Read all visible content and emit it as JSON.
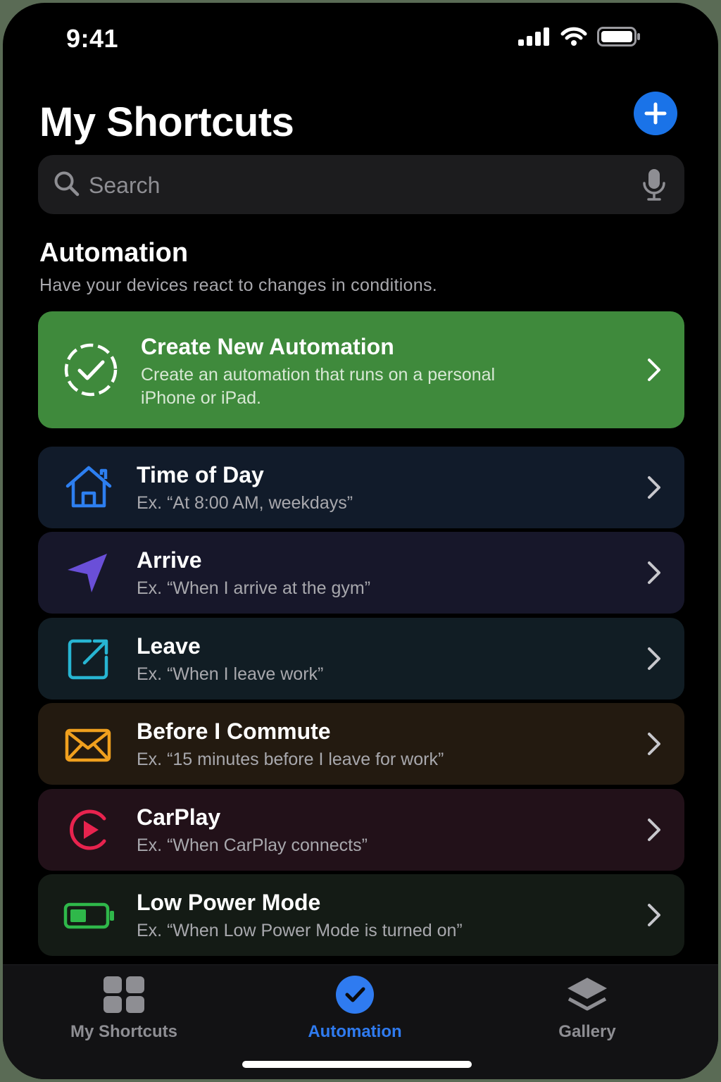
{
  "status_bar": {
    "time": "9:41"
  },
  "header": {
    "title": "My Shortcuts"
  },
  "search": {
    "placeholder": "Search"
  },
  "section": {
    "title": "Automation",
    "subtitle": "Have your devices react to changes in conditions."
  },
  "create_card": {
    "title": "Create New Automation",
    "desc": "Create an automation that runs on a personal iPhone or iPad."
  },
  "items": [
    {
      "title": "Time of Day",
      "desc": "Ex. “At 8:00 AM, weekdays”",
      "icon": "house-icon",
      "color": "#2d7ff0",
      "bg": "#111b2a"
    },
    {
      "title": "Arrive",
      "desc": "Ex. “When I arrive at the gym”",
      "icon": "location-arrow-icon",
      "color": "#6a4fd8",
      "bg": "#17172a"
    },
    {
      "title": "Leave",
      "desc": "Ex. “When I leave work”",
      "icon": "arrow-up-right-square-icon",
      "color": "#27b5d2",
      "bg": "#111d24"
    },
    {
      "title": "Before I Commute",
      "desc": "Ex. “15 minutes before I leave for work”",
      "icon": "envelope-icon",
      "color": "#f0a01e",
      "bg": "#231a10"
    },
    {
      "title": "CarPlay",
      "desc": "Ex. “When CarPlay connects”",
      "icon": "play-circle-icon",
      "color": "#e8234e",
      "bg": "#221119"
    },
    {
      "title": "Low Power Mode",
      "desc": "Ex. “When Low Power Mode is turned on”",
      "icon": "battery-low-icon",
      "color": "#2fb84a",
      "bg": "#141b15"
    }
  ],
  "tabs": [
    {
      "label": "My Shortcuts",
      "icon": "grid-icon",
      "active": false
    },
    {
      "label": "Automation",
      "icon": "checkmark-circle-icon",
      "active": true
    },
    {
      "label": "Gallery",
      "icon": "layers-icon",
      "active": false
    }
  ],
  "colors": {
    "accent": "#1a73e8",
    "create_green": "#3f8a3c",
    "tab_active": "#2f7bf0"
  }
}
